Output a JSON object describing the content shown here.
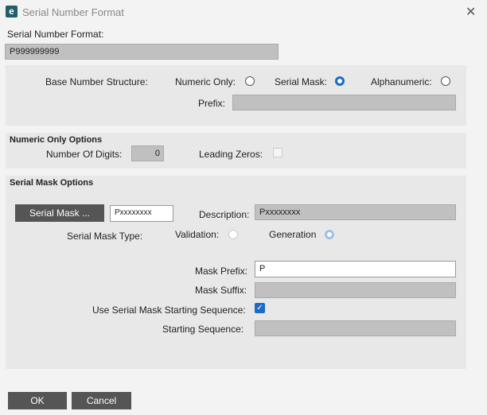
{
  "window": {
    "title": "Serial Number Format",
    "close": "✕"
  },
  "format": {
    "label": "Serial Number Format:",
    "value": "P999999999"
  },
  "base": {
    "label": "Base Number Structure:",
    "numeric": "Numeric Only:",
    "mask": "Serial Mask:",
    "alpha": "Alphanumeric:",
    "prefix": "Prefix:",
    "prefix_value": "",
    "selected": "Serial Mask"
  },
  "numeric": {
    "header": "Numeric Only Options",
    "digits_label": "Number Of Digits:",
    "digits": "0",
    "zeros_label": "Leading Zeros:",
    "leading_zeros": false
  },
  "mask": {
    "header": "Serial Mask Options",
    "button": "Serial Mask ...",
    "mask_value": "Pxxxxxxxx",
    "desc_label": "Description:",
    "desc": "Pxxxxxxxx",
    "type_label": "Serial Mask Type:",
    "validation": "Validation:",
    "generation": "Generation",
    "selected_type": "Generation",
    "prefix_label": "Mask Prefix:",
    "prefix": "P",
    "suffix_label": "Mask Suffix:",
    "suffix": "",
    "use_seq_label": "Use Serial Mask Starting Sequence:",
    "use_seq": true,
    "seq_label": "Starting Sequence:",
    "seq": ""
  },
  "buttons": {
    "ok": "OK",
    "cancel": "Cancel"
  }
}
